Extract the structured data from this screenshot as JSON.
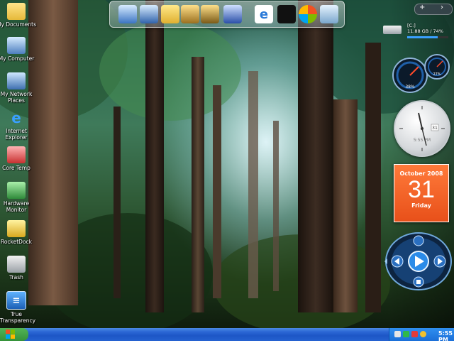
{
  "desktop": {
    "icons": [
      {
        "label": "My Documents"
      },
      {
        "label": "My Computer"
      },
      {
        "label": "My Network Places"
      },
      {
        "label": "Internet Explorer"
      },
      {
        "label": "Core Temp"
      },
      {
        "label": "Hardware Monitor"
      },
      {
        "label": "RocketDock"
      },
      {
        "label": "Trash"
      },
      {
        "label": "True Transparency"
      }
    ]
  },
  "dock": {
    "items": [
      "my-computer-icon",
      "network-icon",
      "folder-icon",
      "video-folder-icon",
      "music-folder-icon",
      "winamp-icon",
      "internet-explorer-icon",
      "tshirt-icon",
      "windows-flag-icon",
      "recycle-bin-icon"
    ]
  },
  "sidebar": {
    "add": "+",
    "next": "›",
    "drive": {
      "label": "[C:]",
      "usage": "11.88 GB / 74%",
      "percent": 74
    },
    "gauges": {
      "cpu_text": "38%",
      "mem_text": "27%"
    },
    "clock": {
      "digital": "5:55 PM",
      "date_box": "31"
    },
    "calendar": {
      "month_year": "October 2008",
      "day": "31",
      "weekday": "Friday"
    }
  },
  "taskbar": {
    "time": "5:55 PM"
  },
  "colors": {
    "taskbar": "#2462d0",
    "start": "#35923a",
    "calendar": "#e8501a"
  }
}
